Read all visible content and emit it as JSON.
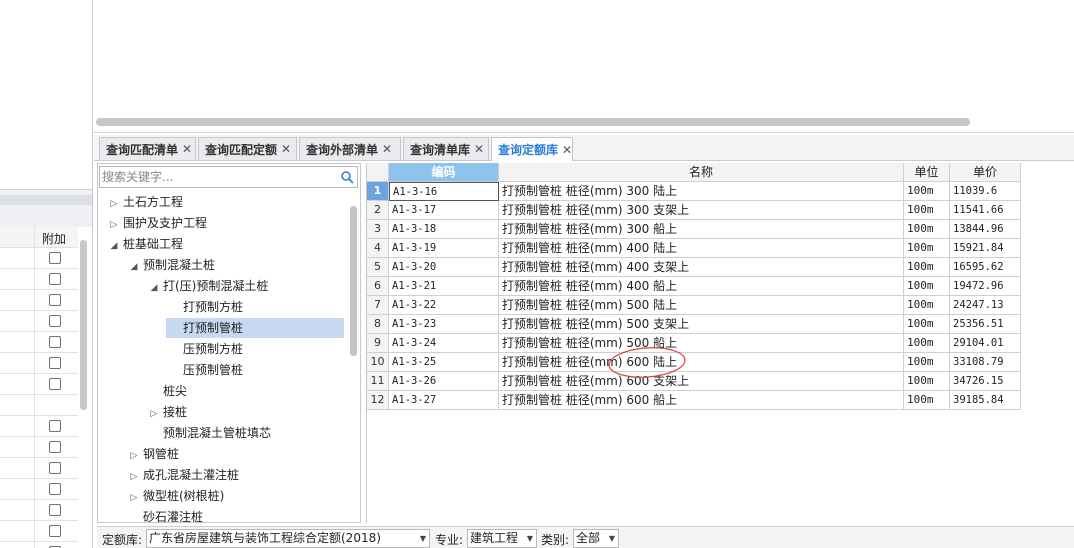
{
  "left_panel": {
    "column_header": "附加",
    "checkbox_rows": 15
  },
  "tabs": [
    {
      "label": "查询匹配清单",
      "close": "✕",
      "active": false
    },
    {
      "label": "查询匹配定额",
      "close": "✕",
      "active": false
    },
    {
      "label": "查询外部清单",
      "close": "✕",
      "active": false
    },
    {
      "label": "查询清单库",
      "close": "✕",
      "active": false
    },
    {
      "label": "查询定额库",
      "close": "✕",
      "active": true
    }
  ],
  "tree": {
    "search_placeholder": "搜索关键字...",
    "items": [
      {
        "label": "土石方工程",
        "arrow": "▷",
        "level": 0
      },
      {
        "label": "围护及支护工程",
        "arrow": "▷",
        "level": 0
      },
      {
        "label": "桩基础工程",
        "arrow": "◢",
        "level": 0
      },
      {
        "label": "预制混凝土桩",
        "arrow": "◢",
        "level": 1
      },
      {
        "label": "打(压)预制混凝土桩",
        "arrow": "◢",
        "level": 2
      },
      {
        "label": "打预制方桩",
        "arrow": "",
        "level": 3
      },
      {
        "label": "打预制管桩",
        "arrow": "",
        "level": 3,
        "selected": true
      },
      {
        "label": "压预制方桩",
        "arrow": "",
        "level": 3
      },
      {
        "label": "压预制管桩",
        "arrow": "",
        "level": 3
      },
      {
        "label": "桩尖",
        "arrow": "",
        "level": 2
      },
      {
        "label": "接桩",
        "arrow": "▷",
        "level": 2
      },
      {
        "label": "预制混凝土管桩填芯",
        "arrow": "",
        "level": 2
      },
      {
        "label": "钢管桩",
        "arrow": "▷",
        "level": 1
      },
      {
        "label": "成孔混凝土灌注桩",
        "arrow": "▷",
        "level": 1
      },
      {
        "label": "微型桩(树根桩)",
        "arrow": "▷",
        "level": 1
      },
      {
        "label": "砂石灌注桩",
        "arrow": "",
        "level": 1
      }
    ]
  },
  "grid": {
    "headers": {
      "code": "编码",
      "name": "名称",
      "unit": "单位",
      "price": "单价"
    },
    "rows": [
      {
        "num": "1",
        "code": "A1-3-16",
        "name": "打预制管桩 桩径(mm) 300 陆上",
        "unit": "100m",
        "price": "11039.6"
      },
      {
        "num": "2",
        "code": "A1-3-17",
        "name": "打预制管桩 桩径(mm) 300 支架上",
        "unit": "100m",
        "price": "11541.66"
      },
      {
        "num": "3",
        "code": "A1-3-18",
        "name": "打预制管桩 桩径(mm) 300 船上",
        "unit": "100m",
        "price": "13844.96"
      },
      {
        "num": "4",
        "code": "A1-3-19",
        "name": "打预制管桩 桩径(mm) 400 陆上",
        "unit": "100m",
        "price": "15921.84"
      },
      {
        "num": "5",
        "code": "A1-3-20",
        "name": "打预制管桩 桩径(mm) 400 支架上",
        "unit": "100m",
        "price": "16595.62"
      },
      {
        "num": "6",
        "code": "A1-3-21",
        "name": "打预制管桩 桩径(mm) 400 船上",
        "unit": "100m",
        "price": "19472.96"
      },
      {
        "num": "7",
        "code": "A1-3-22",
        "name": "打预制管桩 桩径(mm) 500 陆上",
        "unit": "100m",
        "price": "24247.13"
      },
      {
        "num": "8",
        "code": "A1-3-23",
        "name": "打预制管桩 桩径(mm) 500 支架上",
        "unit": "100m",
        "price": "25356.51"
      },
      {
        "num": "9",
        "code": "A1-3-24",
        "name": "打预制管桩 桩径(mm) 500 船上",
        "unit": "100m",
        "price": "29104.01"
      },
      {
        "num": "10",
        "code": "A1-3-25",
        "name": "打预制管桩 桩径(mm) 600 陆上",
        "unit": "100m",
        "price": "33108.79"
      },
      {
        "num": "11",
        "code": "A1-3-26",
        "name": "打预制管桩 桩径(mm) 600 支架上",
        "unit": "100m",
        "price": "34726.15"
      },
      {
        "num": "12",
        "code": "A1-3-27",
        "name": "打预制管桩 桩径(mm) 600 船上",
        "unit": "100m",
        "price": "39185.84"
      }
    ]
  },
  "bottom_bar": {
    "library_label": "定额库:",
    "library_value": "广东省房屋建筑与装饰工程综合定额(2018)",
    "major_label": "专业:",
    "major_value": "建筑工程",
    "category_label": "类别:",
    "category_value": "全部",
    "dropdown_glyph": "▼"
  },
  "colors": {
    "active_tab_text": "#2a7fd4",
    "selected_tree_bg": "#c6d9f1",
    "code_header_bg": "#8ec3ee",
    "annotation_circle": "#d9423a"
  }
}
